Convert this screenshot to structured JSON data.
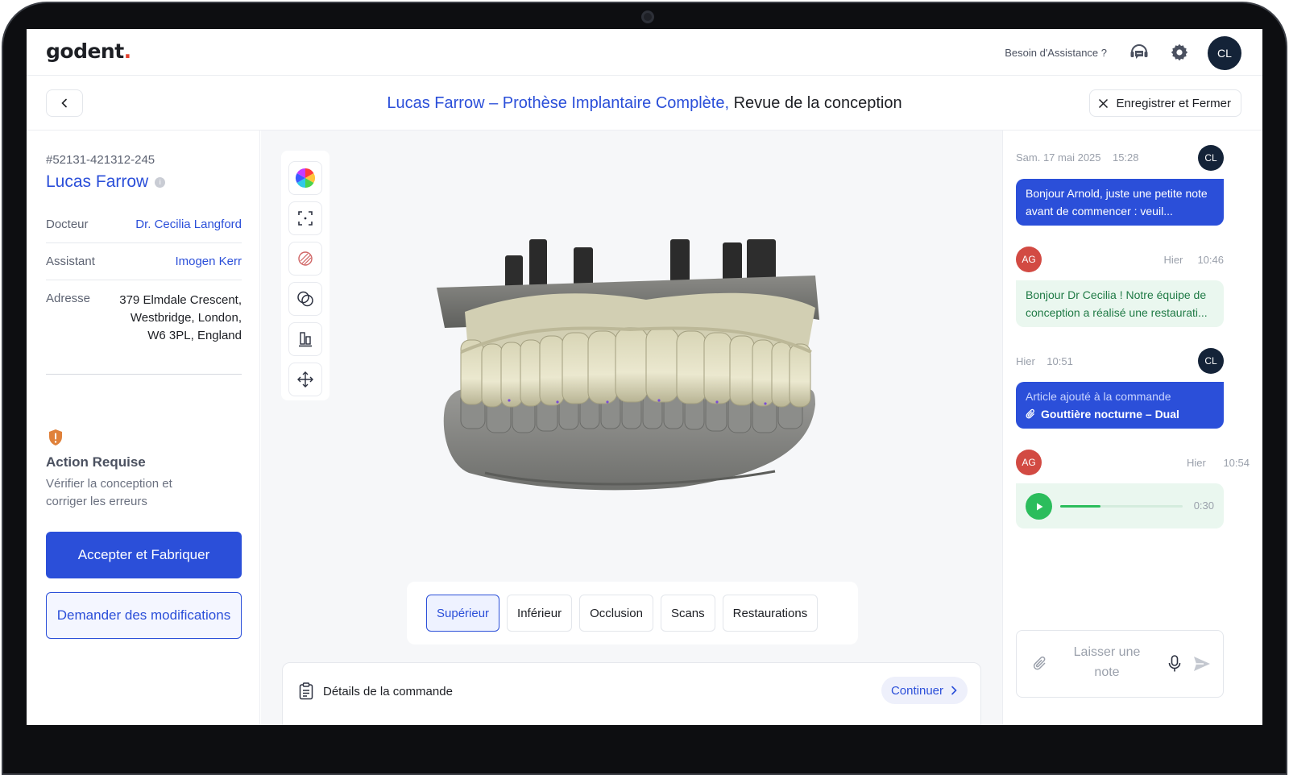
{
  "app": {
    "logo_text": "godent",
    "logo_dot": "."
  },
  "header": {
    "help_text": "Besoin d'Assistance ?",
    "user_initials": "CL"
  },
  "title_bar": {
    "title_patient": "Lucas Farrow – Prothèse Implantaire Complète,",
    "title_section": "Revue de la conception",
    "save_close_label": "Enregistrer et Fermer"
  },
  "patient": {
    "order_id": "#52131-421312-245",
    "name": "Lucas Farrow",
    "doctor_label": "Docteur",
    "doctor_value": "Dr. Cecilia Langford",
    "assistant_label": "Assistant",
    "assistant_value": "Imogen Kerr",
    "address_label": "Adresse",
    "address_lines": [
      "379 Elmdale Crescent,",
      "Westbridge, London,",
      "W6 3PL, England"
    ]
  },
  "action": {
    "title": "Action Requise",
    "description": "Vérifier la conception et corriger les erreurs",
    "accept_label": "Accepter et Fabriquer",
    "request_label": "Demander des modifications"
  },
  "viewer": {
    "tools": [
      "color-wheel-icon",
      "focus-frame-icon",
      "hatch-circle-icon",
      "overlap-circles-icon",
      "align-bottom-icon",
      "move-arrows-icon"
    ],
    "tabs": [
      "Supérieur",
      "Inférieur",
      "Occlusion",
      "Scans",
      "Restaurations"
    ],
    "active_tab": "Supérieur"
  },
  "details": {
    "label": "Détails de la commande",
    "continue_label": "Continuer"
  },
  "chat": {
    "messages": [
      {
        "date": "Sam. 17 mai 2025",
        "time": "15:28",
        "avatar": "CL",
        "text": "Bonjour Arnold, juste une petite note avant de commencer : veuil..."
      },
      {
        "date": "Hier",
        "time": "10:46",
        "avatar": "AG",
        "text": "Bonjour Dr Cecilia ! Notre équipe de conception a réalisé une restaurati..."
      },
      {
        "date": "Hier",
        "time": "10:51",
        "avatar": "CL",
        "text": "Article ajouté à la commande",
        "attachment": "Gouttière nocturne – Dual"
      },
      {
        "date": "Hier",
        "time": "10:54",
        "avatar": "AG",
        "audio_duration": "0:30",
        "audio_progress": 0.33
      }
    ],
    "note_placeholder": "Laisser une note"
  },
  "colors": {
    "primary": "#2b4fd9",
    "avatar_navy": "#142338",
    "avatar_red": "#d24a43",
    "chat_green": "#2bbd5c",
    "warning": "#e0813a"
  }
}
